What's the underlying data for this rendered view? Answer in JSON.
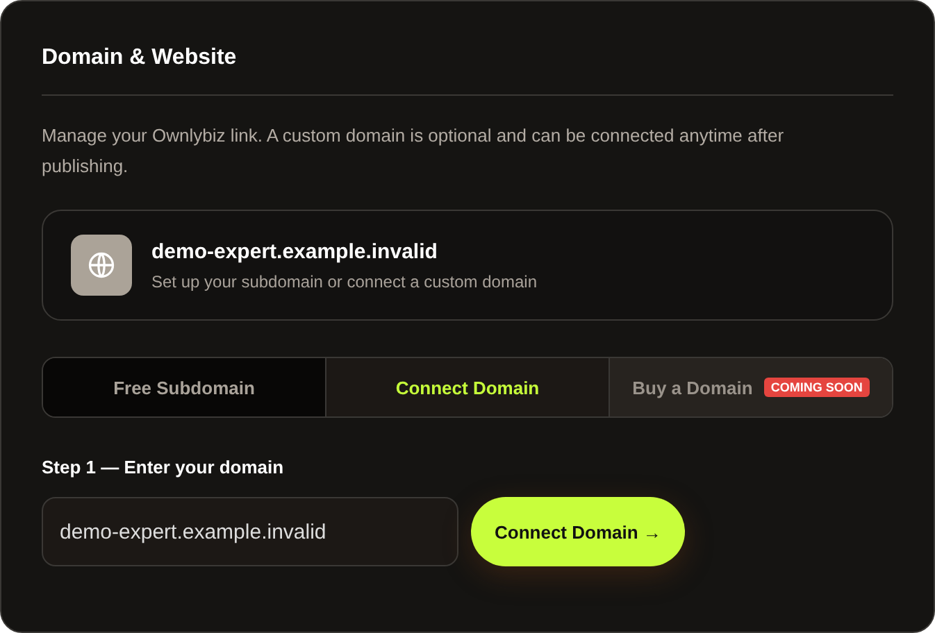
{
  "panel": {
    "title": "Domain & Website",
    "description": "Manage your Ownlybiz link. A custom domain is optional and can be connected anytime after publishing."
  },
  "domain_card": {
    "domain": "demo-expert.example.invalid",
    "subtitle": "Set up your subdomain or connect a custom domain"
  },
  "tabs": [
    {
      "label": "Free Subdomain",
      "selected": false,
      "disabled": false
    },
    {
      "label": "Connect Domain",
      "selected": true,
      "disabled": false
    },
    {
      "label": "Buy a Domain",
      "selected": false,
      "disabled": true,
      "badge": "COMING SOON"
    }
  ],
  "step": {
    "label": "Step 1 — Enter your domain",
    "value": "demo-expert.example.invalid",
    "button": "Connect Domain →"
  }
}
